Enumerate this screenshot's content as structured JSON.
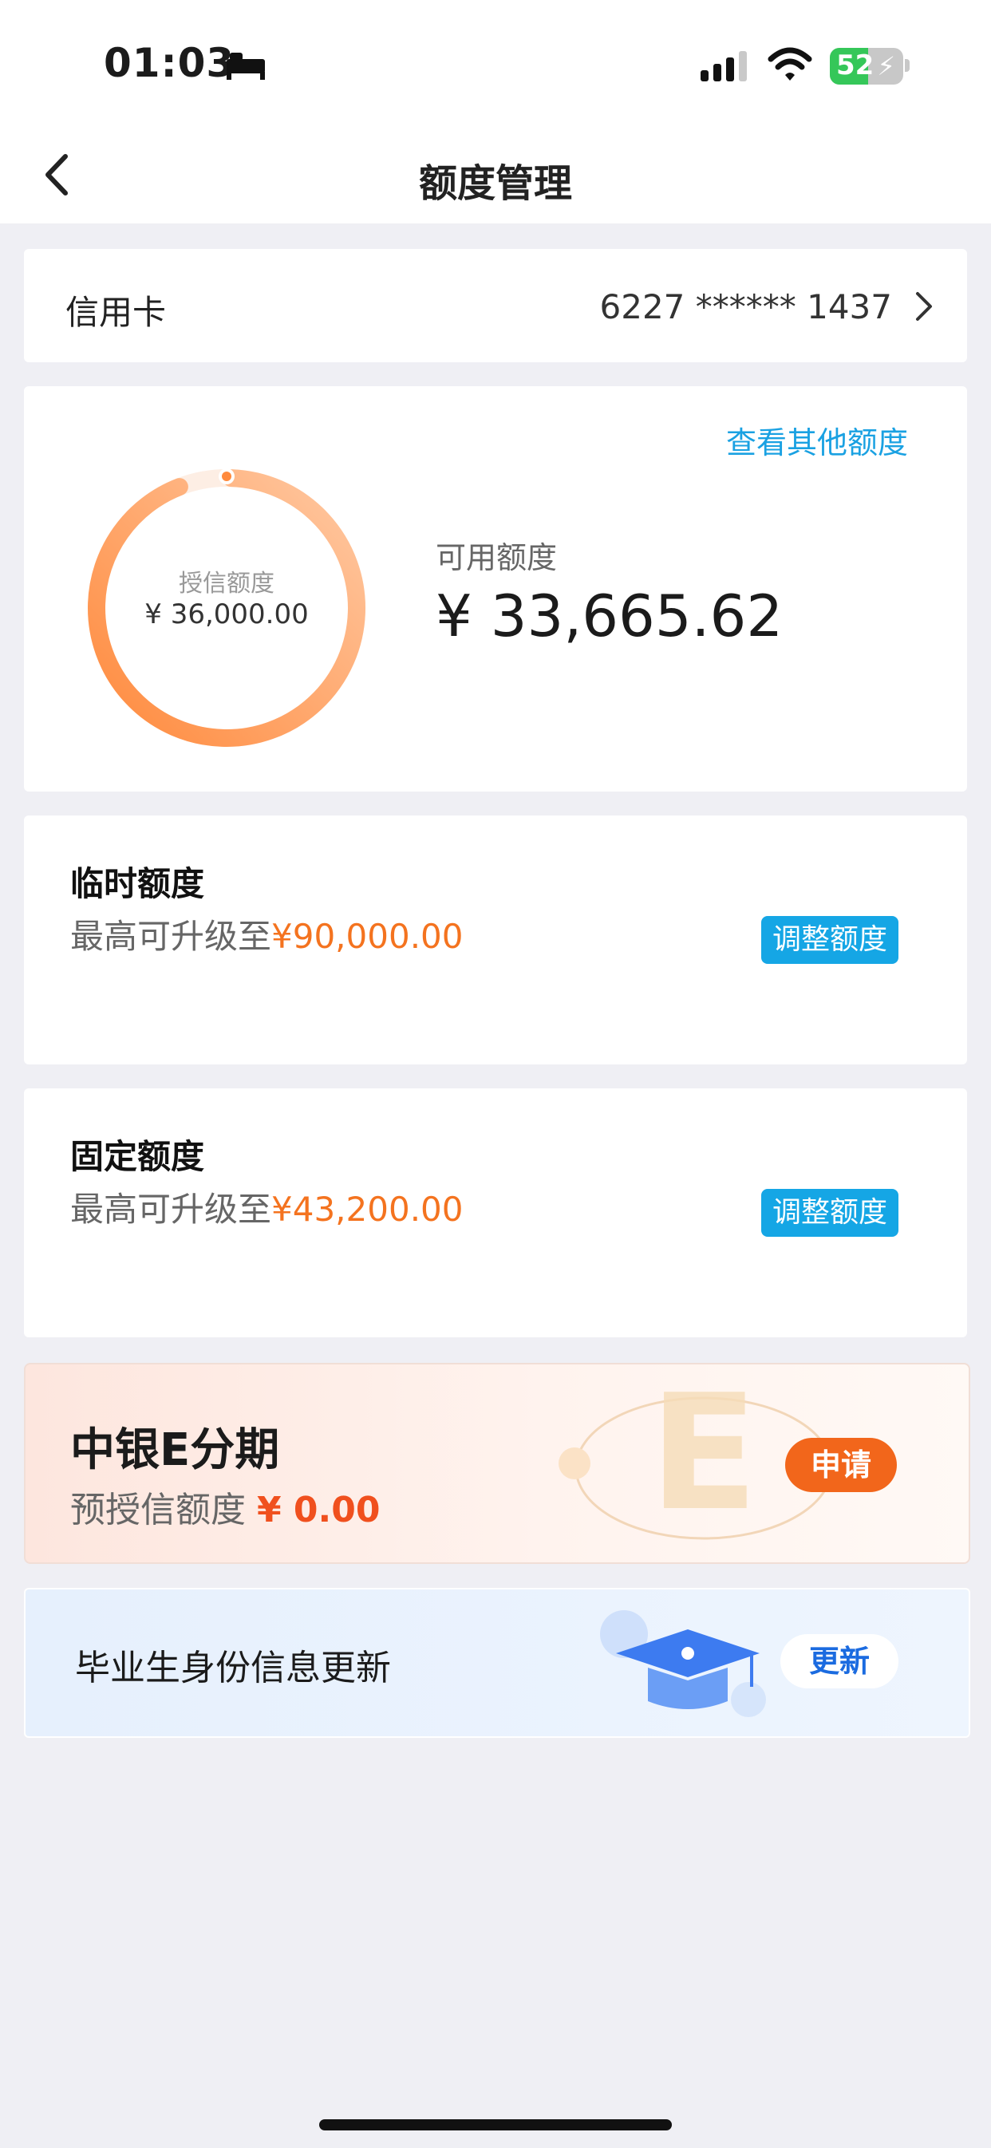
{
  "status_bar": {
    "time": "01:03",
    "battery_text": "52",
    "battery_level_percent": 52
  },
  "nav": {
    "title": "额度管理"
  },
  "account": {
    "label": "信用卡",
    "card_number": "6227 ****** 1437"
  },
  "limit": {
    "other_link": "查看其他额度",
    "ring_label": "授信额度",
    "ring_value": "¥ 36,000.00",
    "available_label": "可用额度",
    "available_value": "¥ 33,665.62",
    "used_fraction": 0.935
  },
  "temporary": {
    "title": "临时额度",
    "sub_prefix": "最高可升级至",
    "sub_amount": "¥90,000.00",
    "button": "调整额度"
  },
  "fixed": {
    "title": "固定额度",
    "sub_prefix": "最高可升级至",
    "sub_amount": "¥43,200.00",
    "button": "调整额度"
  },
  "fenqi": {
    "title": "中银E分期",
    "sub_prefix": "预授信额度",
    "sub_amount": "¥ 0.00",
    "button": "申请",
    "deco_letter": "E"
  },
  "graduate": {
    "title": "毕业生身份信息更新",
    "button": "更新"
  },
  "colors": {
    "accent_blue": "#15a6e5",
    "accent_orange": "#f4731f",
    "apply_orange": "#f2661b",
    "update_blue": "#1b6be0"
  }
}
